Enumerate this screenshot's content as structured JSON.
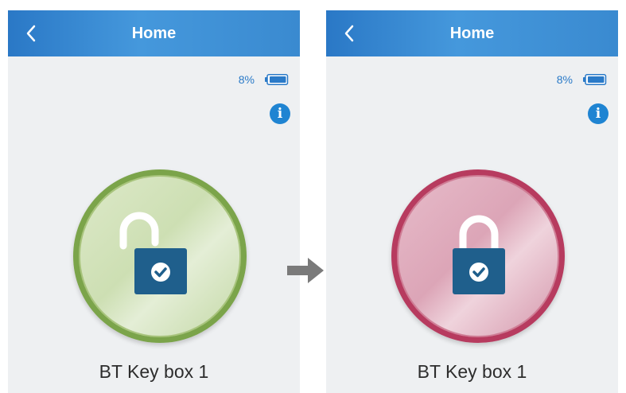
{
  "screens": [
    {
      "nav_title": "Home",
      "battery_percent": "8%",
      "info_icon": "info-icon",
      "lock_state": "unlocked",
      "lock_color": "#7ba44a",
      "device_name": "BT Key box 1"
    },
    {
      "nav_title": "Home",
      "battery_percent": "8%",
      "info_icon": "info-icon",
      "lock_state": "locked",
      "lock_color": "#b73b5f",
      "device_name": "BT Key box 1"
    }
  ],
  "icons": {
    "back": "chevron-left-icon",
    "battery": "battery-icon",
    "padlock": "padlock-icon",
    "transition": "arrow-right-icon"
  },
  "colors": {
    "nav_bar": "#3a8ad0",
    "accent": "#2a7ac8",
    "lock_body": "#1f5f8c",
    "background": "#eef0f2",
    "arrow": "#7a7a7a"
  }
}
